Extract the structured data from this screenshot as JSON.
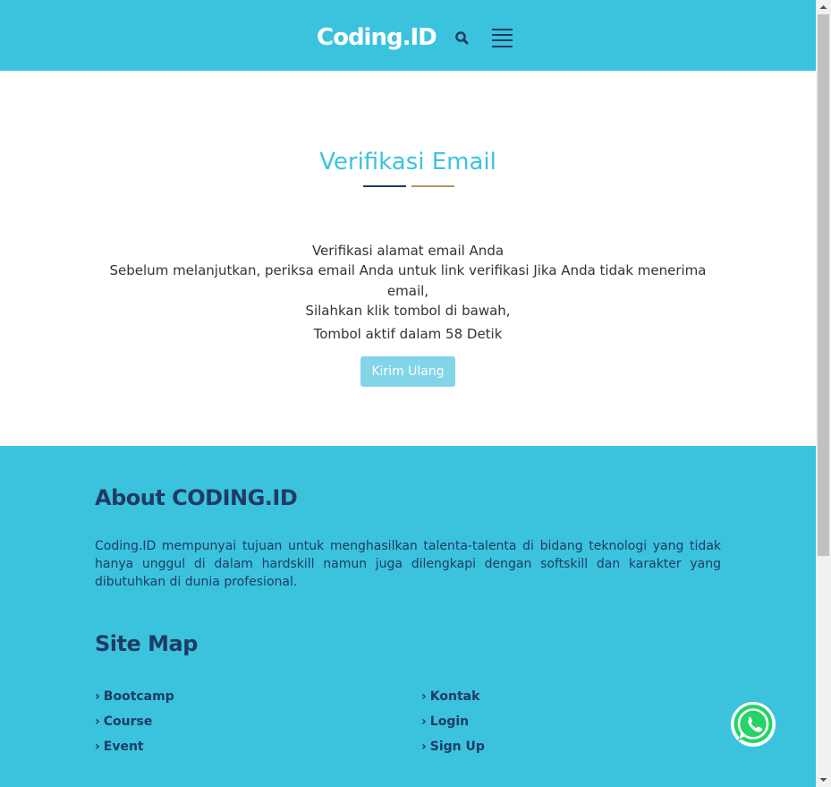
{
  "header": {
    "logo": "Coding.ID",
    "search_icon": "search-icon",
    "menu_icon": "hamburger-menu-icon"
  },
  "main": {
    "title": "Verifikasi Email",
    "line1": "Verifikasi alamat email Anda",
    "line2": "Sebelum melanjutkan, periksa email Anda untuk link verifikasi Jika Anda tidak menerima email,",
    "line3": "Silahkan klik tombol di bawah,",
    "line4": "Tombol aktif dalam 58 Detik",
    "countdown_seconds": 58,
    "resend_button": "Kirim Ulang"
  },
  "footer": {
    "about_title": "About CODING.ID",
    "about_text": "Coding.ID mempunyai tujuan untuk menghasilkan talenta-talenta di bidang teknologi yang tidak hanya unggul di dalam hardskill namun juga dilengkapi dengan softskill dan karakter yang dibutuhkan di dunia profesional.",
    "sitemap_title": "Site Map",
    "links_left": [
      "Bootcamp",
      "Course",
      "Event"
    ],
    "links_right": [
      "Kontak",
      "Login",
      "Sign Up"
    ]
  },
  "colors": {
    "brand": "#3bc3de",
    "navy": "#1f3b64",
    "gold": "#b8926a",
    "button_disabled": "#82d4e8",
    "whatsapp": "#25d366"
  },
  "whatsapp": {
    "icon": "whatsapp-icon"
  }
}
